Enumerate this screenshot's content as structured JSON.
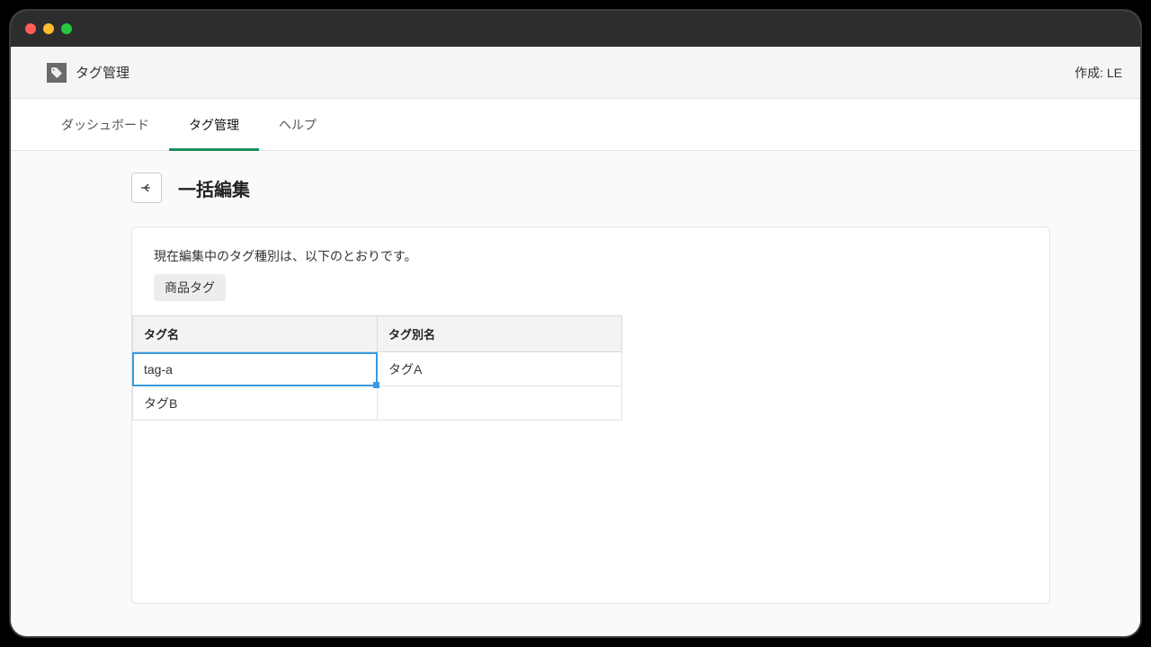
{
  "header": {
    "app_title": "タグ管理",
    "right_text": "作成: LE"
  },
  "tabs": {
    "items": [
      {
        "label": "ダッシュボード",
        "active": false
      },
      {
        "label": "タグ管理",
        "active": true
      },
      {
        "label": "ヘルプ",
        "active": false
      }
    ]
  },
  "page": {
    "title": "一括編集",
    "description": "現在編集中のタグ種別は、以下のとおりです。",
    "chip": "商品タグ"
  },
  "grid": {
    "headers": {
      "name": "タグ名",
      "alias": "タグ別名"
    },
    "rows": [
      {
        "name": "tag-a",
        "alias": "タグA",
        "selected": true
      },
      {
        "name": "タグB",
        "alias": "",
        "selected": false
      }
    ]
  }
}
